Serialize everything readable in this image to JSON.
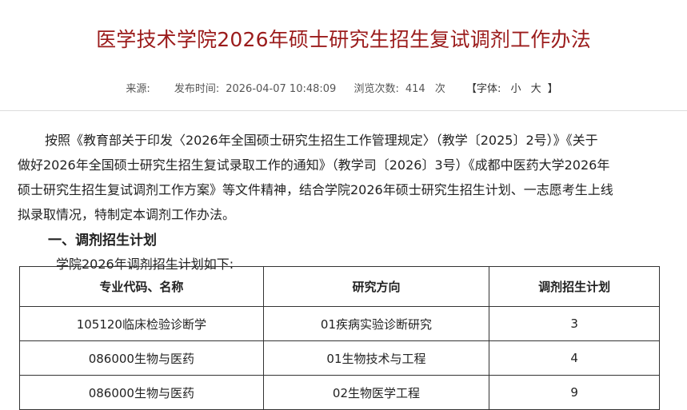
{
  "article": {
    "title": "医学技术学院2026年硕士研究生招生复试调剂工作办法",
    "meta": {
      "source_label": "来源:",
      "source_value": "",
      "published_label": "发布时间:",
      "published_value": "2026-04-07 10:48:09",
      "views_label": "浏览次数:",
      "views_value": "414",
      "views_unit": "次",
      "font_size_label": "【字体:",
      "font_small": "小",
      "font_large": "大",
      "font_size_close": "】"
    },
    "paragraphs": [
      "按照《教育部关于印发〈2026年全国硕士研究生招生工作管理规定〉（教学〔2025〕2号）》《关于",
      "做好2026年全国硕士研究生招生复试录取工作的通知》（教学司〔2026〕3号）《成都中医药大学2026年",
      "硕士研究生招生复试调剂工作方案》等文件精神，结合学院2026年硕士研究生招生计划、一志愿考生上线",
      "拟录取情况，特制定本调剂工作办法。"
    ],
    "section_heading": "一、调剂招生计划",
    "section_intro": "学院2026年调剂招生计划如下:"
  },
  "plan_table": {
    "headers": [
      "专业代码、名称",
      "研究方向",
      "调剂招生计划"
    ],
    "rows": [
      [
        "105120临床检验诊断学",
        "01疾病实验诊断研究",
        "3"
      ],
      [
        "086000生物与医药",
        "01生物技术与工程",
        "4"
      ],
      [
        "086000生物与医药",
        "02生物医学工程",
        "9"
      ]
    ]
  }
}
